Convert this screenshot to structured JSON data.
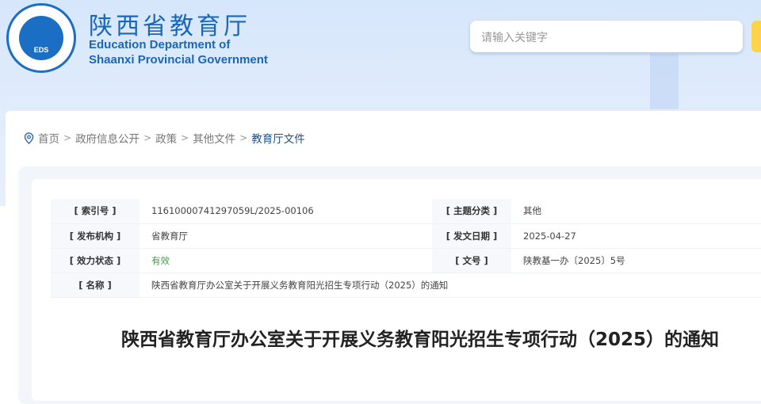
{
  "header": {
    "site_name_cn": "陕西省教育厅",
    "site_name_en_1": "Education Department of",
    "site_name_en_2": "Shaanxi Provincial Government",
    "logo_text": "EDS",
    "search_placeholder": "请输入关键字"
  },
  "breadcrumb": [
    "首页",
    "政府信息公开",
    "政策",
    "其他文件",
    "教育厅文件"
  ],
  "breadcrumb_sep": ">",
  "meta": {
    "index_label": "[ 索引号 ]",
    "index_value": "11610000741297059L/2025-00106",
    "topic_label": "[ 主题分类 ]",
    "topic_value": "其他",
    "publisher_label": "[ 发布机构 ]",
    "publisher_value": "省教育厅",
    "date_label": "[ 发文日期 ]",
    "date_value": "2025-04-27",
    "status_label": "[ 效力状态 ]",
    "status_value": "有效",
    "docno_label": "[ 文号 ]",
    "docno_value": "陕教基一办〔2025〕5号",
    "name_label": "[ 名称 ]",
    "name_value": "陕西省教育厅办公室关于开展义务教育阳光招生专项行动（2025）的通知"
  },
  "article": {
    "title": "陕西省教育厅办公室关于开展义务教育阳光招生专项行动（2025）的通知"
  },
  "colors": {
    "brand": "#1a67b8",
    "status_valid": "#3aa33a",
    "search_button": "#fdd34a"
  }
}
